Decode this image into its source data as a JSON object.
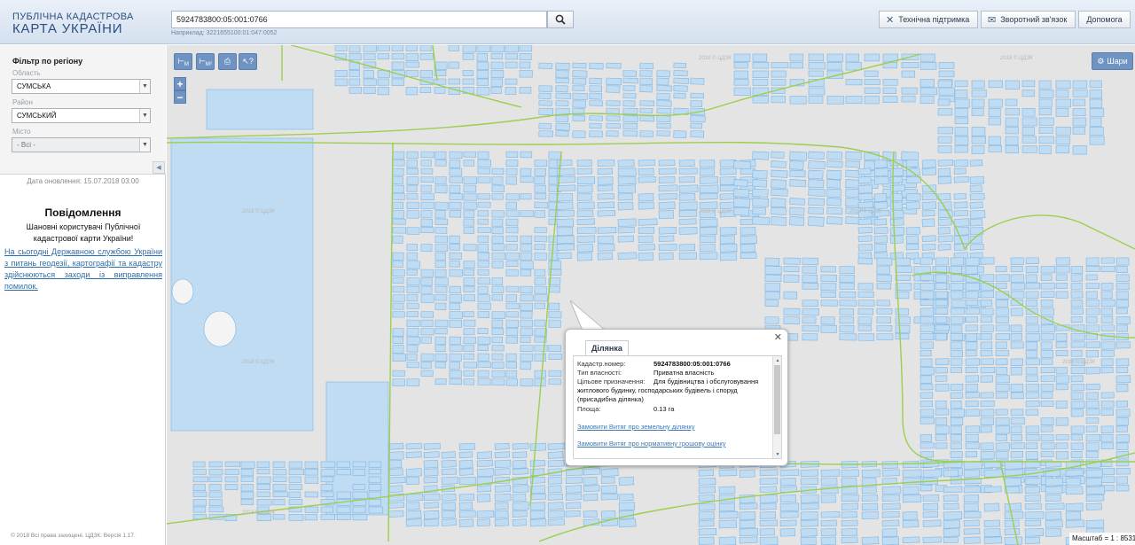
{
  "header": {
    "logo_line1": "ПУБЛІЧНА КАДАСТРОВА",
    "logo_line2": "КАРТА УКРАЇНИ",
    "search_value": "5924783800:05:001:0766",
    "search_hint": "Наприклад: 3221655100:01:047:0052",
    "tech_support_label": "Технічна підтримка",
    "feedback_label": "Зворотний зв'язок",
    "help_label": "Допомога"
  },
  "sidebar": {
    "filter_title": "Фільтр по регіону",
    "region_label": "Область",
    "region_value": "СУМСЬКА",
    "district_label": "Район",
    "district_value": "СУМСЬКИЙ",
    "city_label": "Місто",
    "city_value": "- Всі -",
    "update_date": "Дата оновлення: 15.07.2018 03:00",
    "notice_title": "Повідомлення",
    "notice_text": "Шановні користувачі Публічної кадастрової карти України!",
    "notice_link": "На сьогодні Державною службою України з питань геодезії, картографії та кадастру здійснюються заходи із виправлення помилок.",
    "copyright": "© 2018 Всі права захищені. ЦДЗК. Версія 1.17."
  },
  "map": {
    "tool_measure_line": "М",
    "tool_measure_area": "М²",
    "zoom_in": "+",
    "zoom_out": "−",
    "layers_label": "Шари",
    "scale_text": "Масштаб = 1 : 8531",
    "watermark": "2018 © ЦДЗК"
  },
  "popup": {
    "tab_label": "Ділянка",
    "cadastral_key": "Кадастр.номер:",
    "cadastral_value": "5924783800:05:001:0766",
    "ownership_key": "Тип власності:",
    "ownership_value": "Приватна власність",
    "purpose_key": "Цільове призначення:",
    "purpose_value_line1": "Для будівництва і обслуговування",
    "purpose_value_line2": "житлового будинку, господарських будівель і споруд",
    "purpose_value_line3": "(присадибна ділянка)",
    "area_key": "Площа:",
    "area_value": "0.13 га",
    "link_extract": "Замовити Витяг про земельну ділянку",
    "link_valuation": "Замовити Витяг про нормативну грошову оцінку"
  },
  "colors": {
    "parcel_fill": "#bfdcf3",
    "parcel_stroke": "#7fb4e0",
    "boundary": "#9ccf4f",
    "map_bg": "#e4e4e4",
    "tool_blue": "#6f93c2"
  }
}
